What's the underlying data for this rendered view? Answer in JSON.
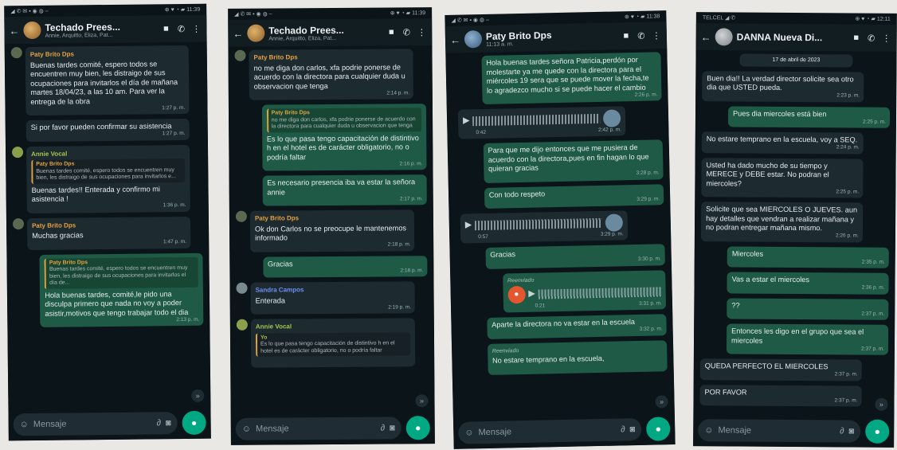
{
  "phones": [
    {
      "status": {
        "left": "◢ ✆ ✉ ▪ ◉ ◍ –",
        "right": "⊕ ♥ ◔ ▰ 11:39"
      },
      "title": "Techado Prees...",
      "subtitle": "Annie, Arquitto, Eliza, Pat...",
      "messages": [
        {
          "sender": "Paty Brito Dps",
          "text": "Buenas tardes comité, espero todos se encuentren muy bien, les distraigo de sus ocupaciones para invitarlos el día de mañana martes 18/04/23, a las 10 am. Para ver la entrega de la obra",
          "time": "1:27 p. m."
        },
        {
          "text": "Si por favor pueden confirmar su asistencia",
          "time": "1:27 p. m."
        },
        {
          "sender": "Annie Vocal",
          "quote_sender": "Paty Brito Dps",
          "quote": "Buenas tardes comité, espero todos se encuentren muy bien, les distraigo de sus ocupaciones para invitarlos e...",
          "text": "Buenas tardes!! Enterada y confirmo mi asistencia !",
          "time": "1:36 p. m."
        },
        {
          "sender": "Paty Brito Dps",
          "text": "Muchas gracias",
          "time": "1:47 p. m."
        },
        {
          "quote_sender": "Paty Brito Dps",
          "quote": "Buenas tardes comité, espero todos se encuentren muy bien, les distraigo de sus ocupaciones para invitarlos el día de...",
          "text": "Hola buenas tardes, comité,le pido una disculpa primero que nada no voy a poder asistir,motivos que tengo trabajar todo el dia",
          "time": "2:13 p. m."
        }
      ],
      "input_placeholder": "Mensaje"
    },
    {
      "status": {
        "left": "◢ ✆ ✉ ▪ ◉ ◍ –",
        "right": "⊕ ♥ ◔ ▰ 11:39"
      },
      "title": "Techado Prees...",
      "subtitle": "Annie, Arquitto, Eliza, Pat...",
      "messages": [
        {
          "sender": "Paty Brito Dps",
          "text": "no me diga don carlos, xfa podrie ponerse de acuerdo con la directora para cualquier duda u observacion que tenga",
          "time": "2:14 p. m."
        },
        {
          "quote_sender": "Paty Brito Dps",
          "quote": "no me diga don carlos, xfa podrie ponerse de acuerdo con la directora para cualquier duda u observacion que tenga",
          "text": "Es lo que pasa tengo capacitación de distintivo h en el hotel es de carácter obligatorio, no o podría faltar",
          "time": "2:16 p. m."
        },
        {
          "text": "Es necesario presencia iba va estar la señora annie",
          "time": "2:17 p. m."
        },
        {
          "sender": "Paty Brito Dps",
          "text": "Ok don Carlos no se preocupe le mantenemos informado",
          "time": "2:18 p. m."
        },
        {
          "text": "Gracias",
          "time": "2:18 p. m."
        },
        {
          "sender": "Sandra Campos",
          "text": "Enterada",
          "time": "2:19 p. m."
        },
        {
          "sender": "Annie Vocal",
          "quote_sender": "Yo",
          "quote": "Es lo que pasa tengo capacitación de distintivo h en el hotel es de carácter obligatorio, no o podría faltar",
          "text": "",
          "time": ""
        }
      ],
      "input_placeholder": "Mensaje"
    },
    {
      "status": {
        "left": "◢ ✆ ✉ ▪ ◉ ◍ –",
        "right": "⊕ ♥ ◔ ▰ 11:38"
      },
      "title": "Paty Brito Dps",
      "subtitle": "11:13 a. m.",
      "messages": [
        {
          "text": "Hola buenas tardes señora Patricia,perdón por molestarte ya me quede con la directora para el miércoles 19 sera que se puede mover la fecha,te lo agradezco mucho si se puede hacer el cambio",
          "time": "2:26 p. m."
        },
        {
          "voice": true,
          "duration": "0:42",
          "time": "2:42 p. m."
        },
        {
          "text": "Para que me dijo entonces que me pusiera de acuerdo con la directora,pues en fin hagan lo que quieran gracias",
          "time": "3:28 p. m."
        },
        {
          "text": "Con todo respeto",
          "time": "3:29 p. m."
        },
        {
          "voice": true,
          "duration": "0:57",
          "time": "3:29 p. m."
        },
        {
          "text": "Gracias",
          "time": "3:30 p. m."
        },
        {
          "voice_out": true,
          "forward": "Reenviado",
          "duration": "0:21",
          "time": "3:31 p. m."
        },
        {
          "text": "Aparte la directora no va estar en la escuela",
          "time": "3:32 p. m."
        },
        {
          "forward": "Reenviado",
          "text": "No estare temprano en la escuela,",
          "time": ""
        }
      ],
      "input_placeholder": "Mensaje"
    },
    {
      "status": {
        "left": "TELCEL ◢ ✆",
        "right": "⊕ ♥ ◔ ▰ 12:11"
      },
      "title": "DANNA Nueva Di...",
      "subtitle": "",
      "date_chip": "17 de abril de 2023",
      "messages": [
        {
          "text": "Buen dia!! La verdad director solicite sea otro dia que USTED pueda.",
          "time": "2:23 p. m."
        },
        {
          "out": true,
          "text": "Pues dia miercoles está bien",
          "time": "2:25 p. m."
        },
        {
          "text": "No estare temprano en la escuela, voy a SEQ.",
          "time": "2:24 p. m."
        },
        {
          "text": "Usted ha dado mucho de su tiempo y MERECE y DEBE estar. No podran el miercoles?",
          "time": "2:25 p. m."
        },
        {
          "text": "Solicite que sea MIERCOLES O JUEVES. aun hay detalles que vendran a realizar mañana y no podran entregar mañana mismo.",
          "time": "2:26 p. m."
        },
        {
          "out": true,
          "text": "Miercoles",
          "time": "2:35 p. m."
        },
        {
          "out": true,
          "text": "Vas a estar el miercoles",
          "time": "2:36 p. m."
        },
        {
          "out": true,
          "text": "??",
          "time": "2:37 p. m."
        },
        {
          "out": true,
          "text": "Entonces les digo en el grupo que sea el miercoles",
          "time": "2:37 p. m."
        },
        {
          "text": "QUEDA PERFECTO EL MIERCOLES",
          "time": "2:37 p. m."
        },
        {
          "text": "POR FAVOR",
          "time": "2:37 p. m."
        }
      ],
      "input_placeholder": "Mensaje"
    }
  ],
  "icons": {
    "back": "back-arrow-icon",
    "video": "video-call-icon",
    "call": "phone-call-icon",
    "menu": "more-vert-icon",
    "emoji": "emoji-icon",
    "attach": "attach-icon",
    "camera": "camera-icon",
    "mic": "mic-icon",
    "play": "play-icon"
  },
  "colors": {
    "incoming": "#1d2a30",
    "outgoing": "#1e5a45",
    "accent": "#00a884",
    "sender_yellow": "#e3a23f",
    "sender_green": "#a7c34b",
    "sender_blue": "#6b8ff0"
  }
}
